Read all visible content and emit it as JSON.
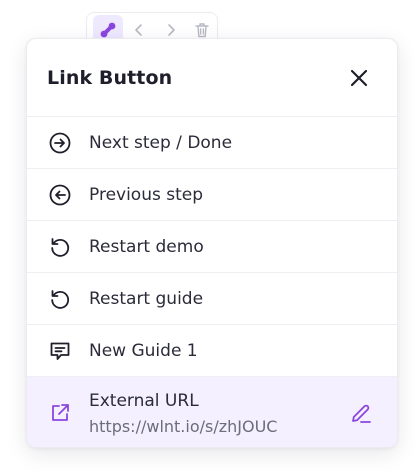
{
  "toolbar": {
    "items": [
      {
        "icon": "link-icon"
      },
      {
        "icon": "chevron-left-icon"
      },
      {
        "icon": "chevron-right-icon"
      },
      {
        "icon": "trash-icon"
      }
    ]
  },
  "panel": {
    "title": "Link Button",
    "items": [
      {
        "label": "Next step / Done",
        "icon": "arrow-right-circle-icon"
      },
      {
        "label": "Previous step",
        "icon": "arrow-left-circle-icon"
      },
      {
        "label": "Restart demo",
        "icon": "restart-icon"
      },
      {
        "label": "Restart guide",
        "icon": "restart-icon"
      },
      {
        "label": "New Guide 1",
        "icon": "guide-message-icon"
      }
    ],
    "selected_item": {
      "label": "External URL",
      "url": "https://wlnt.io/s/zhJOUC",
      "icon": "external-link-icon"
    }
  },
  "colors": {
    "accent": "#8b46e0",
    "selected_bg": "#f4f0ff",
    "text": "#2b2b3a"
  }
}
